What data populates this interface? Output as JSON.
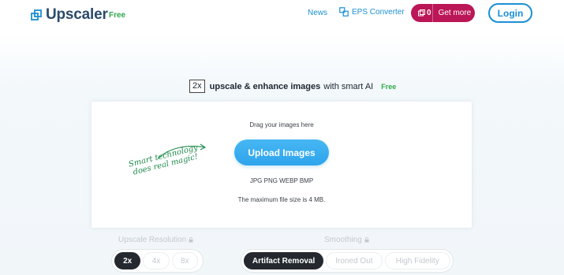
{
  "header": {
    "logo_text": "Upscaler",
    "logo_badge": "Free",
    "nav": {
      "news": "News",
      "eps_converter": "EPS Converter"
    },
    "credits": "0",
    "get_more": "Get more",
    "login": "Login"
  },
  "tagline": {
    "multiplier": "2x",
    "strong": "upscale & enhance images",
    "rest": "with smart AI",
    "badge": "Free"
  },
  "upload": {
    "drag_text": "Drag your images here",
    "button": "Upload Images",
    "formats": "JPG PNG WEBP BMP",
    "max_size": "The maximum file size is 4 MB.",
    "handwritten_line1": "Smart technology",
    "handwritten_line2": "does real magic!"
  },
  "options": {
    "resolution_label": "Upscale Resolution",
    "resolution_options": [
      "2x",
      "4x",
      "8x"
    ],
    "resolution_selected": "2x",
    "smoothing_label": "Smoothing",
    "smoothing_options": [
      "Artifact Removal",
      "Ironed Out",
      "High Fidelity"
    ],
    "smoothing_selected": "Artifact Removal"
  },
  "colors": {
    "brand_blue": "#1b8fd4",
    "accent_magenta": "#bb1657",
    "free_green": "#2ea84a",
    "upload_blue": "#2ea4ec"
  }
}
